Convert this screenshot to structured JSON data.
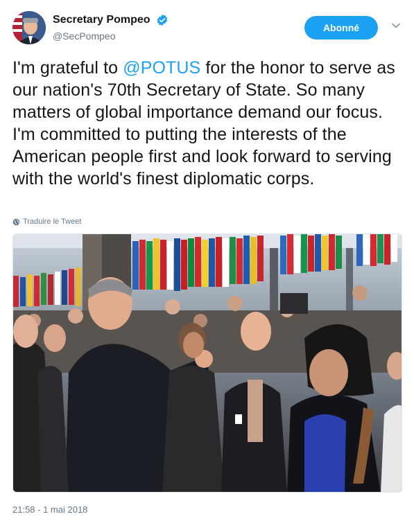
{
  "tweet": {
    "author": {
      "display_name": "Secretary Pompeo",
      "handle": "@SecPompeo",
      "verified_icon": "verified-badge-icon",
      "avatar_icon": "avatar"
    },
    "follow_label": "Abonné",
    "menu_icon": "chevron-down-icon",
    "text_before_mention": "I'm grateful to ",
    "mention": "@POTUS",
    "text_after_mention": " for the honor to serve as our nation's 70th Secretary of State. So many matters of global importance demand our focus. I'm committed to putting the interests of the American people first and look forward to serving with the world's finest diplomatic corps.",
    "translate_label": "Traduire le Tweet",
    "translate_icon": "globe-icon",
    "timestamp": "21:58 - 1 mai 2018"
  },
  "colors": {
    "accent": "#1da1f2",
    "text": "#14171a",
    "secondary": "#657786"
  }
}
